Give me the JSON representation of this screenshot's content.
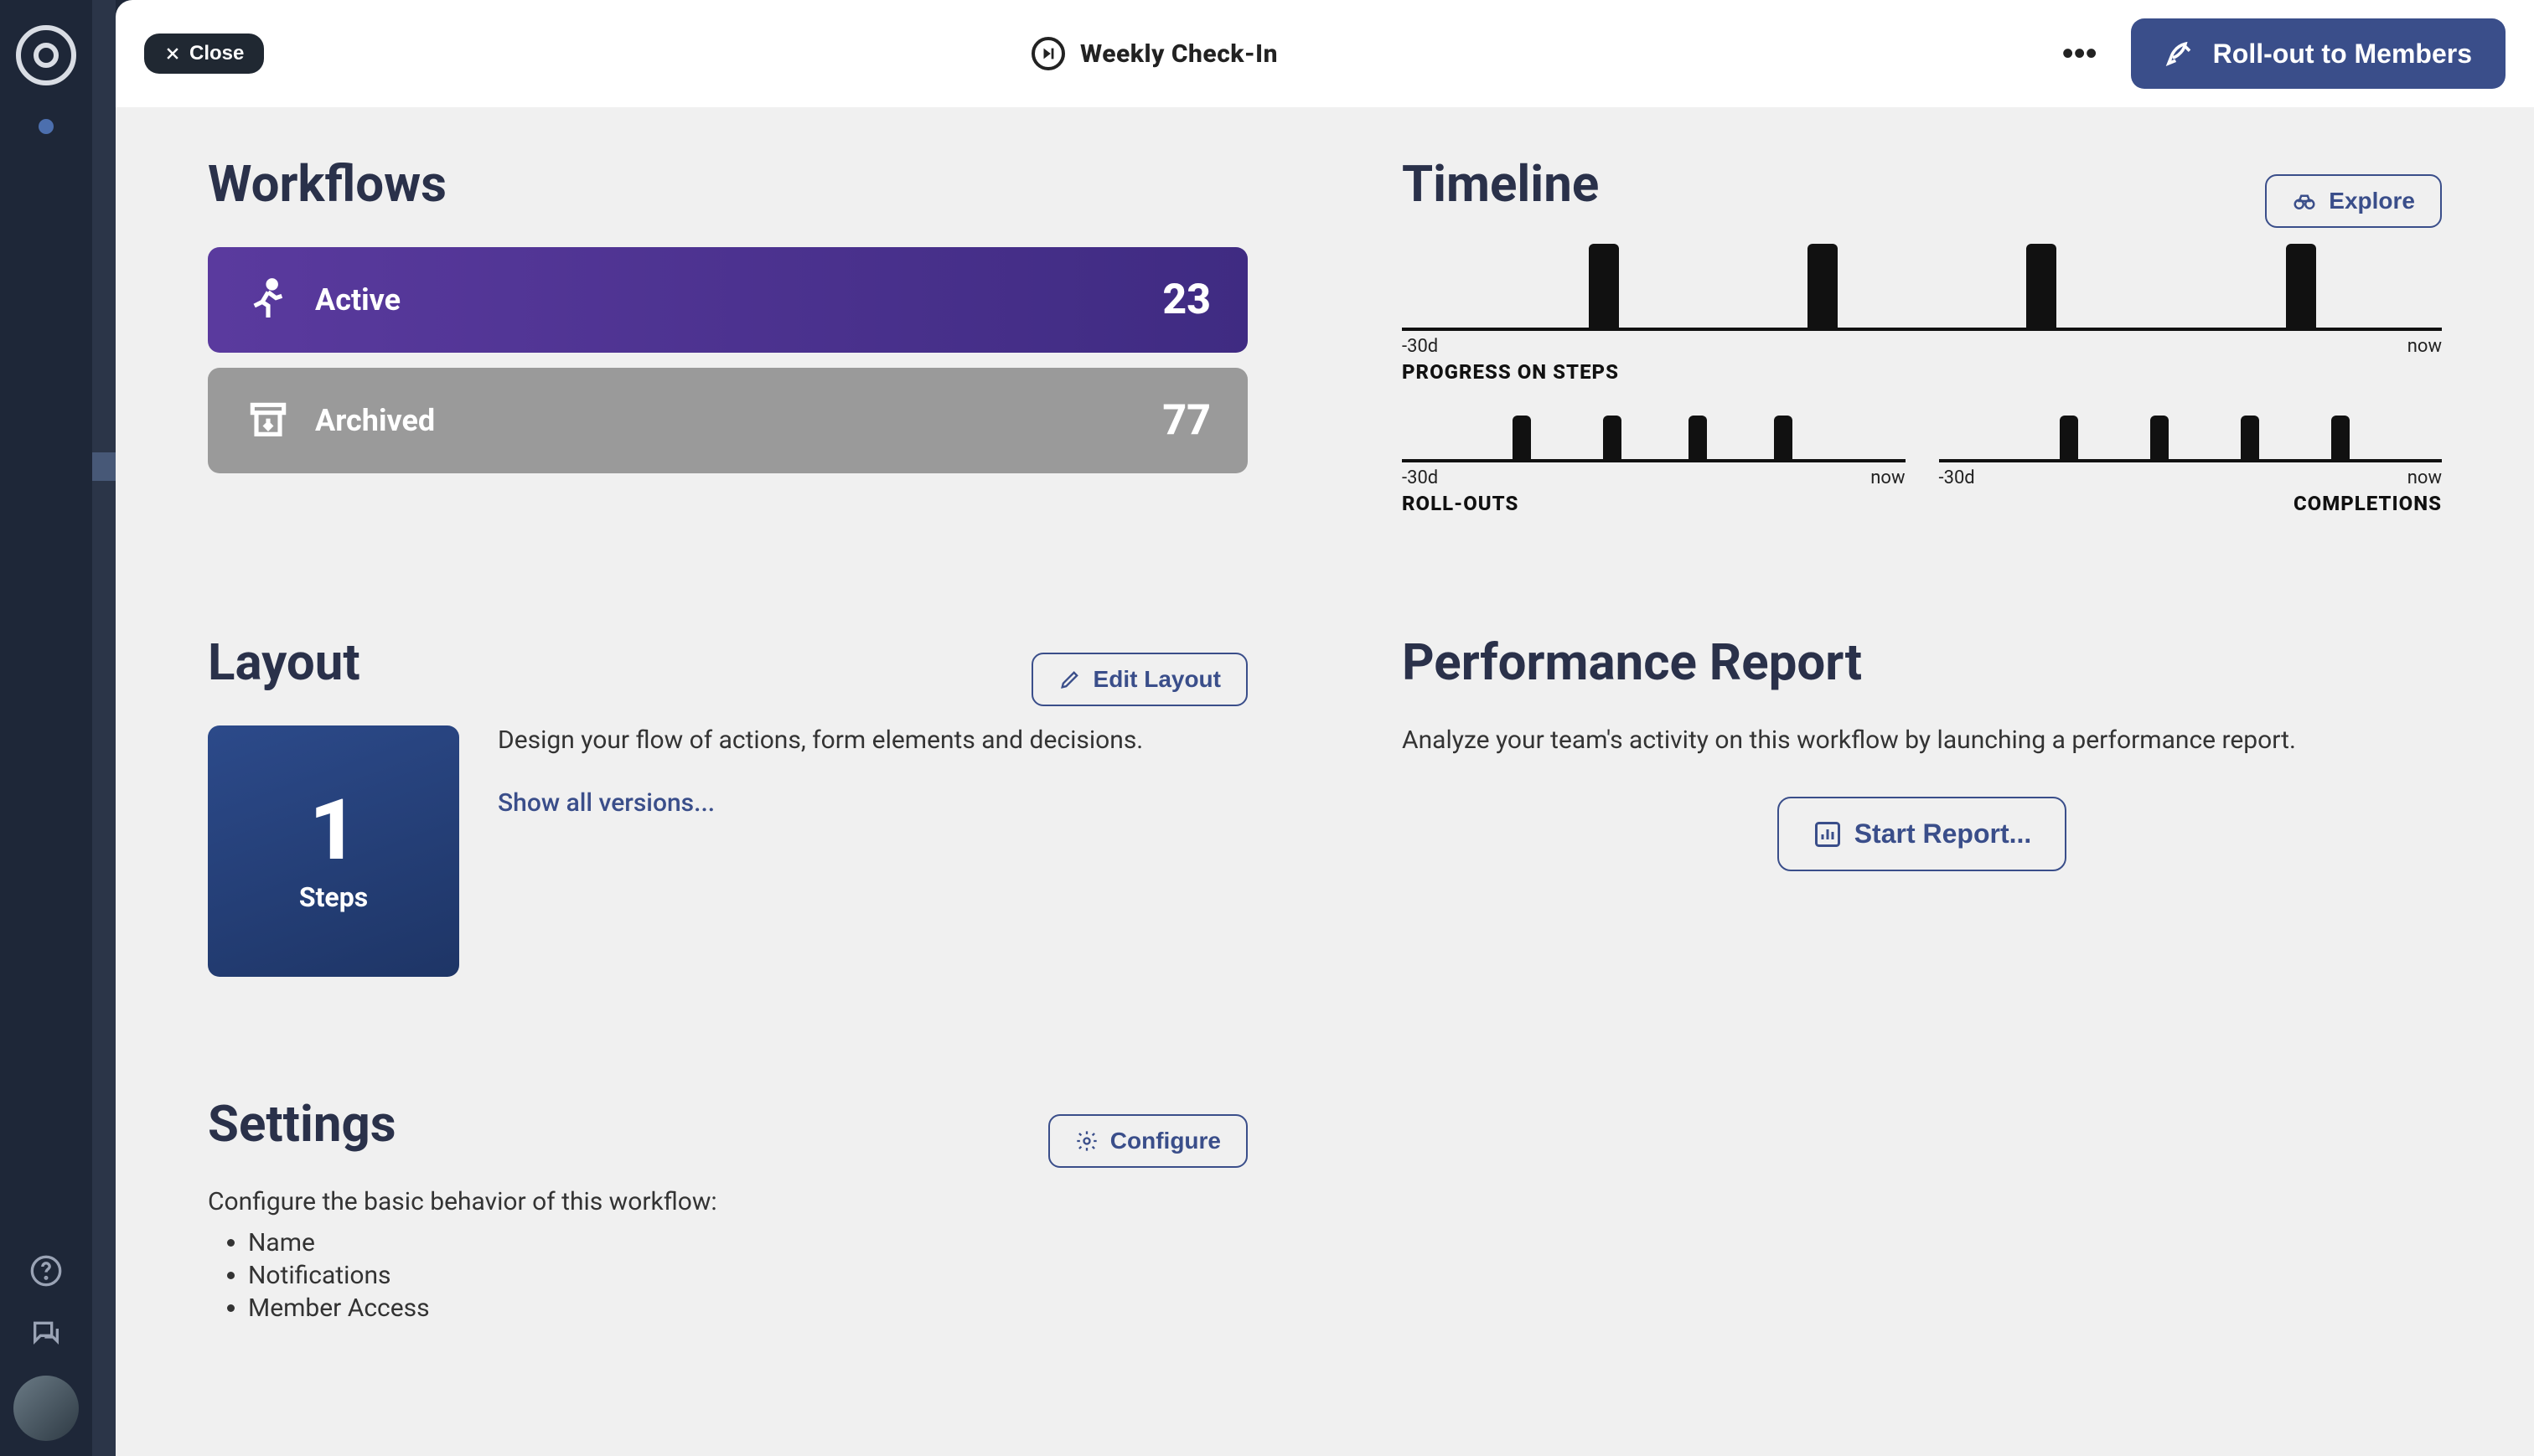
{
  "header": {
    "close_label": "Close",
    "title": "Weekly Check-In",
    "rollout_label": "Roll-out to Members"
  },
  "workflows": {
    "heading": "Workflows",
    "active": {
      "label": "Active",
      "count": "23"
    },
    "archived": {
      "label": "Archived",
      "count": "77"
    }
  },
  "timeline": {
    "heading": "Timeline",
    "explore_label": "Explore",
    "progress_title": "PROGRESS ON STEPS",
    "rollouts_title": "ROLL-OUTS",
    "completions_title": "COMPLETIONS",
    "range_start": "-30d",
    "range_end": "now"
  },
  "layout": {
    "heading": "Layout",
    "edit_label": "Edit Layout",
    "steps_count": "1",
    "steps_label": "Steps",
    "description": "Design your flow of actions, form elements and decisions.",
    "versions_link": "Show all versions..."
  },
  "performance": {
    "heading": "Performance Report",
    "description": "Analyze your team's activity on this workflow by launching a performance report.",
    "start_label": "Start Report..."
  },
  "settings": {
    "heading": "Settings",
    "configure_label": "Configure",
    "description": "Configure the basic behavior of this workflow:",
    "items": [
      "Name",
      "Notifications",
      "Member Access"
    ]
  },
  "chart_data": [
    {
      "type": "bar",
      "title": "PROGRESS ON STEPS",
      "xlabel": "",
      "ylabel": "",
      "x_range": [
        "-30d",
        "now"
      ],
      "categories": [
        "e1",
        "e2",
        "e3",
        "e4"
      ],
      "values": [
        1,
        1,
        1,
        1
      ],
      "positions_pct": [
        18,
        39,
        60,
        85
      ]
    },
    {
      "type": "bar",
      "title": "ROLL-OUTS",
      "x_range": [
        "-30d",
        "now"
      ],
      "categories": [
        "e1",
        "e2",
        "e3",
        "e4"
      ],
      "values": [
        1,
        1,
        1,
        1
      ],
      "positions_pct": [
        22,
        40,
        57,
        74
      ]
    },
    {
      "type": "bar",
      "title": "COMPLETIONS",
      "x_range": [
        "-30d",
        "now"
      ],
      "categories": [
        "e1",
        "e2",
        "e3",
        "e4"
      ],
      "values": [
        1,
        1,
        1,
        1
      ],
      "positions_pct": [
        24,
        42,
        60,
        78
      ]
    }
  ]
}
